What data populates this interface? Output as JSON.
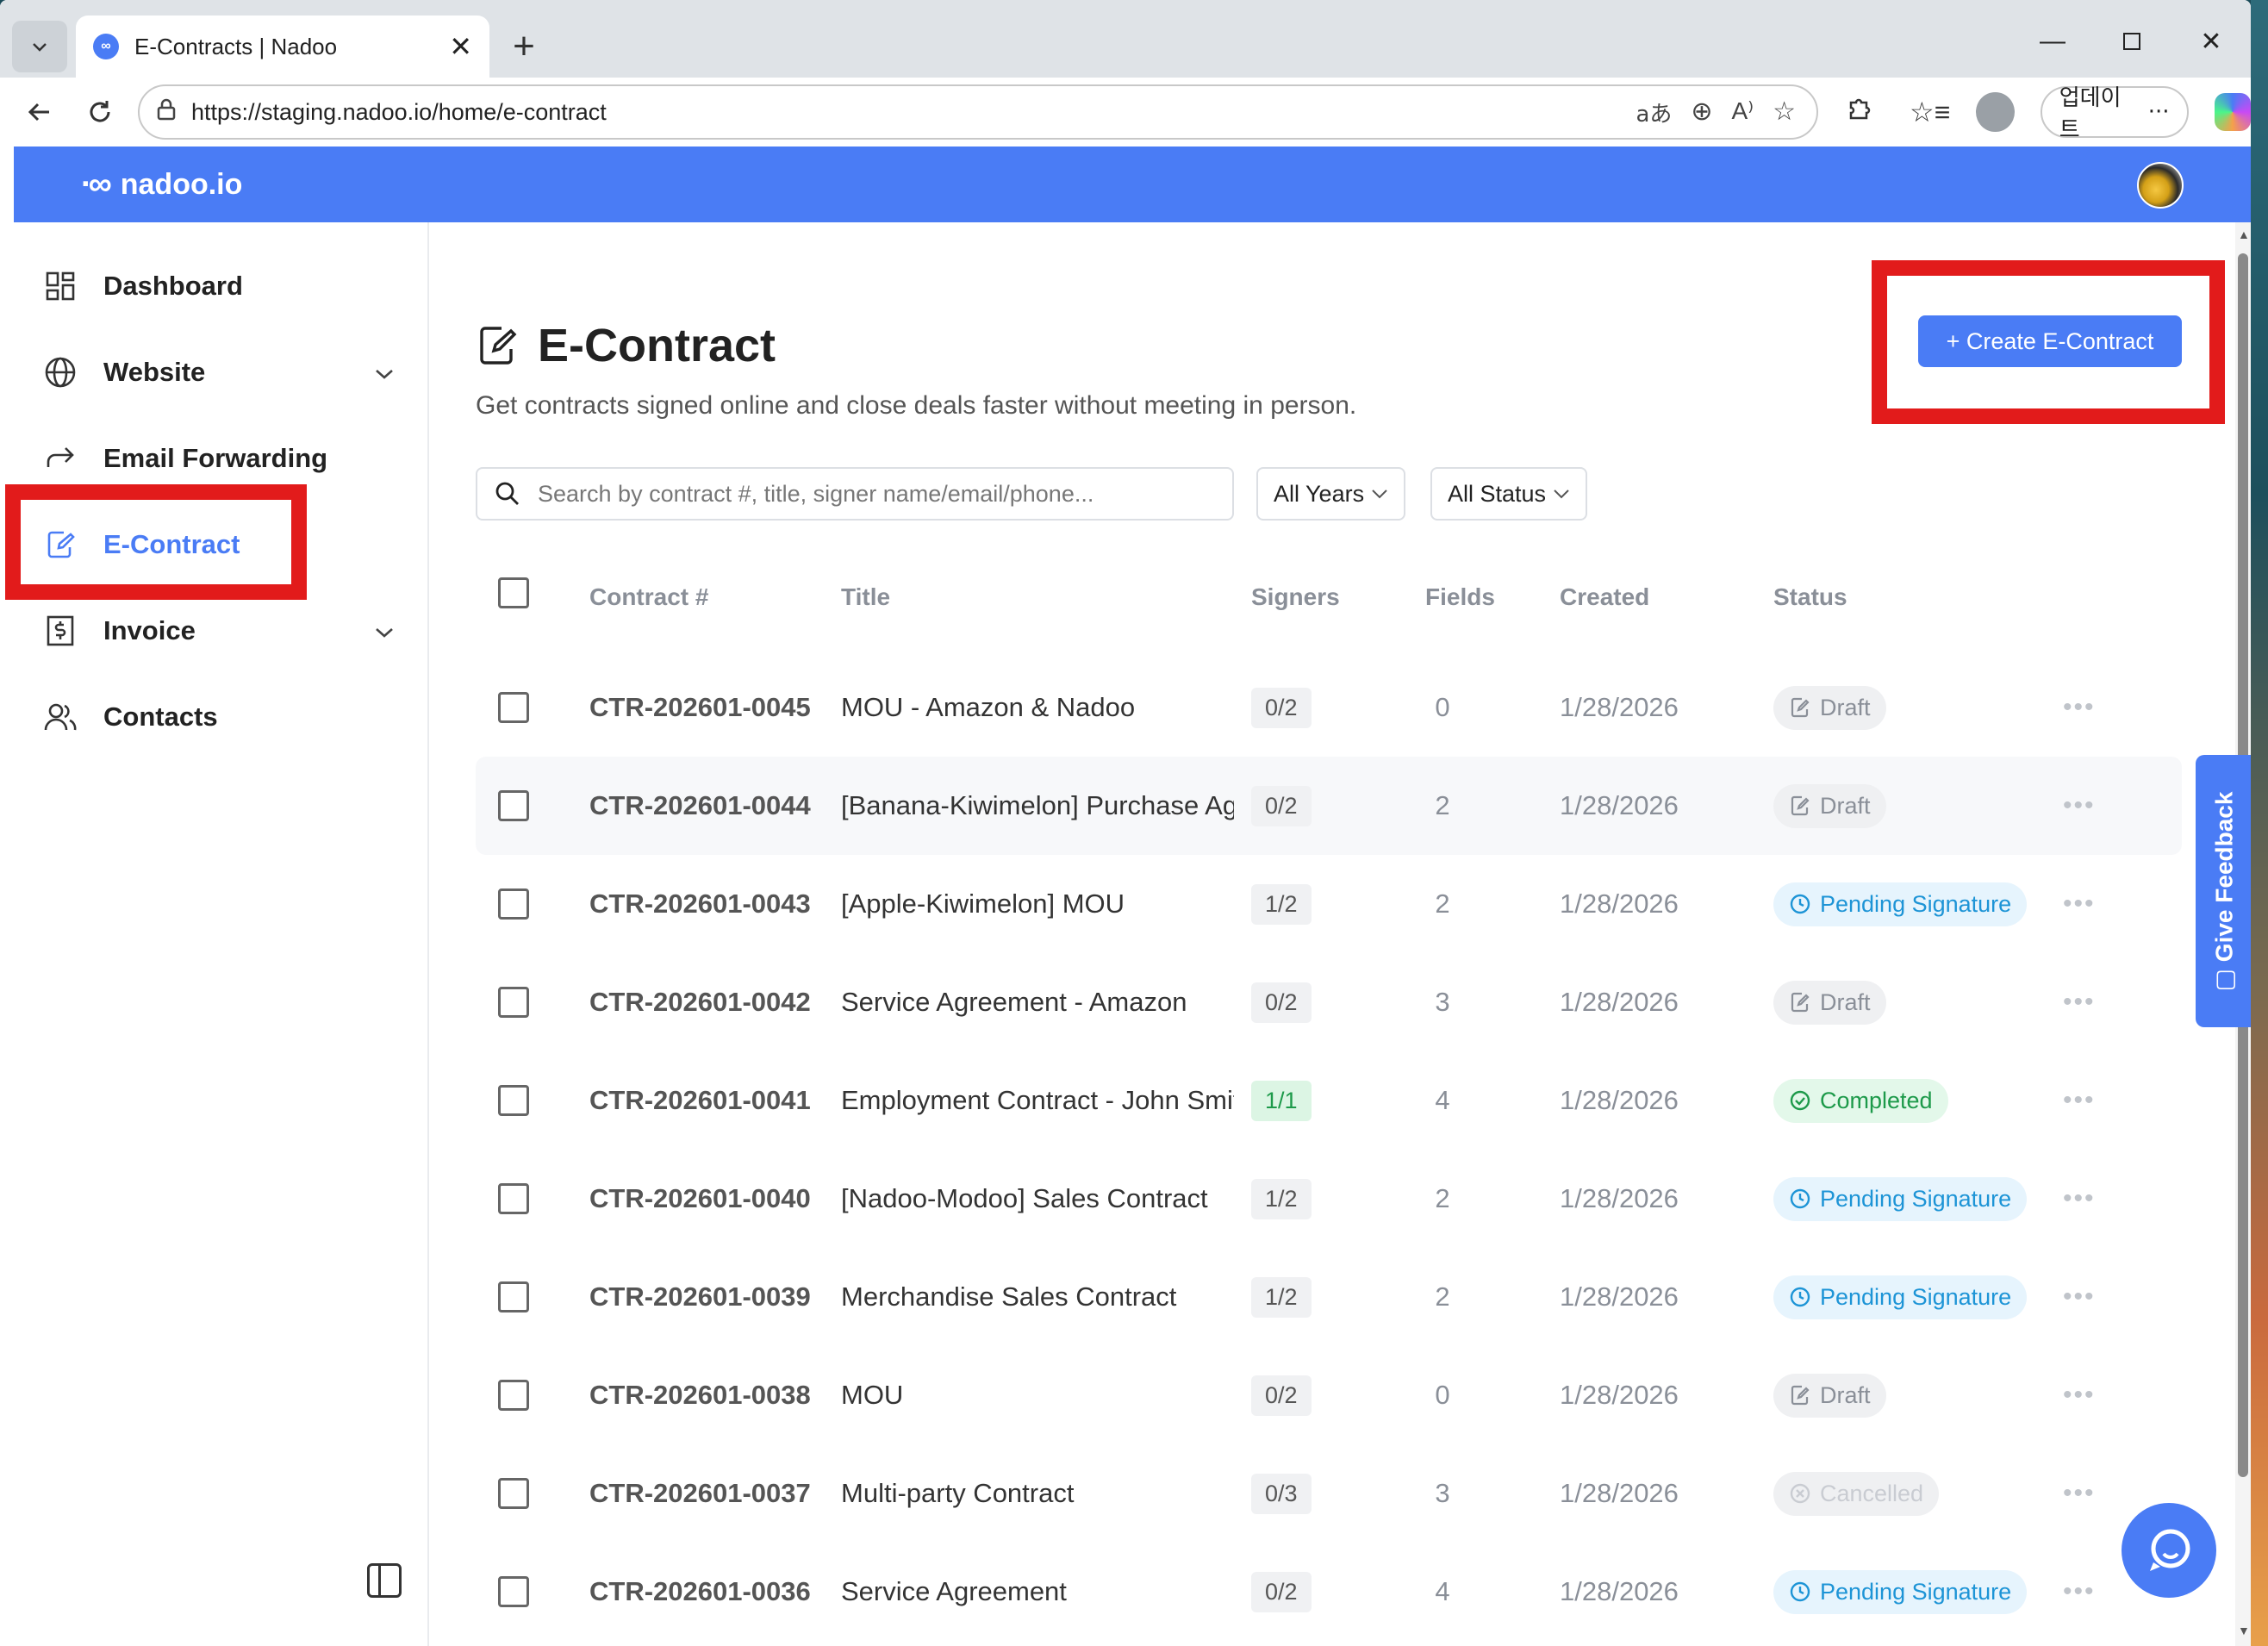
{
  "browser": {
    "tab_title": "E-Contracts | Nadoo",
    "url": "https://staging.nadoo.io/home/e-contract",
    "update_label": "업데이트",
    "update_more": "···"
  },
  "app": {
    "brand": "nadoo.io",
    "brand_color": "#4a7cf5"
  },
  "sidebar": {
    "items": [
      {
        "label": "Dashboard",
        "icon": "dashboard-icon"
      },
      {
        "label": "Website",
        "icon": "globe-icon",
        "expandable": true
      },
      {
        "label": "Email Forwarding",
        "icon": "forward-arrow-icon"
      },
      {
        "label": "E-Contract",
        "icon": "edit-document-icon",
        "active": true
      },
      {
        "label": "Invoice",
        "icon": "dollar-document-icon",
        "expandable": true
      },
      {
        "label": "Contacts",
        "icon": "users-icon"
      }
    ]
  },
  "page": {
    "title": "E-Contract",
    "subtitle": "Get contracts signed online and close deals faster without meeting in person.",
    "create_button": "+ Create E-Contract",
    "search_placeholder": "Search by contract #, title, signer name/email/phone...",
    "year_filter": "All Years",
    "status_filter": "All Status"
  },
  "table": {
    "headers": {
      "number": "Contract #",
      "title": "Title",
      "signers": "Signers",
      "fields": "Fields",
      "created": "Created",
      "status": "Status"
    },
    "rows": [
      {
        "number": "CTR-202601-0045",
        "title": "MOU - Amazon & Nadoo",
        "signers": "0/2",
        "fields": "0",
        "created": "1/28/2026",
        "status": "Draft",
        "status_kind": "draft"
      },
      {
        "number": "CTR-202601-0044",
        "title": "[Banana-Kiwimelon] Purchase Agreement",
        "signers": "0/2",
        "fields": "2",
        "created": "1/28/2026",
        "status": "Draft",
        "status_kind": "draft"
      },
      {
        "number": "CTR-202601-0043",
        "title": "[Apple-Kiwimelon] MOU",
        "signers": "1/2",
        "fields": "2",
        "created": "1/28/2026",
        "status": "Pending Signature",
        "status_kind": "pending"
      },
      {
        "number": "CTR-202601-0042",
        "title": "Service Agreement - Amazon",
        "signers": "0/2",
        "fields": "3",
        "created": "1/28/2026",
        "status": "Draft",
        "status_kind": "draft"
      },
      {
        "number": "CTR-202601-0041",
        "title": "Employment Contract - John Smith",
        "signers": "1/1",
        "fields": "4",
        "created": "1/28/2026",
        "status": "Completed",
        "status_kind": "completed"
      },
      {
        "number": "CTR-202601-0040",
        "title": "[Nadoo-Modoo] Sales Contract",
        "signers": "1/2",
        "fields": "2",
        "created": "1/28/2026",
        "status": "Pending Signature",
        "status_kind": "pending"
      },
      {
        "number": "CTR-202601-0039",
        "title": "Merchandise Sales Contract",
        "signers": "1/2",
        "fields": "2",
        "created": "1/28/2026",
        "status": "Pending Signature",
        "status_kind": "pending"
      },
      {
        "number": "CTR-202601-0038",
        "title": "MOU",
        "signers": "0/2",
        "fields": "0",
        "created": "1/28/2026",
        "status": "Draft",
        "status_kind": "draft"
      },
      {
        "number": "CTR-202601-0037",
        "title": "Multi-party Contract",
        "signers": "0/3",
        "fields": "3",
        "created": "1/28/2026",
        "status": "Cancelled",
        "status_kind": "cancelled"
      },
      {
        "number": "CTR-202601-0036",
        "title": "Service Agreement",
        "signers": "0/2",
        "fields": "4",
        "created": "1/28/2026",
        "status": "Pending Signature",
        "status_kind": "pending"
      }
    ]
  },
  "feedback": {
    "label": "Give Feedback"
  },
  "colors": {
    "highlight": "#e21b1b",
    "accent": "#4a7cf5",
    "pending": "#1d94d6",
    "completed": "#1d9a4a"
  }
}
